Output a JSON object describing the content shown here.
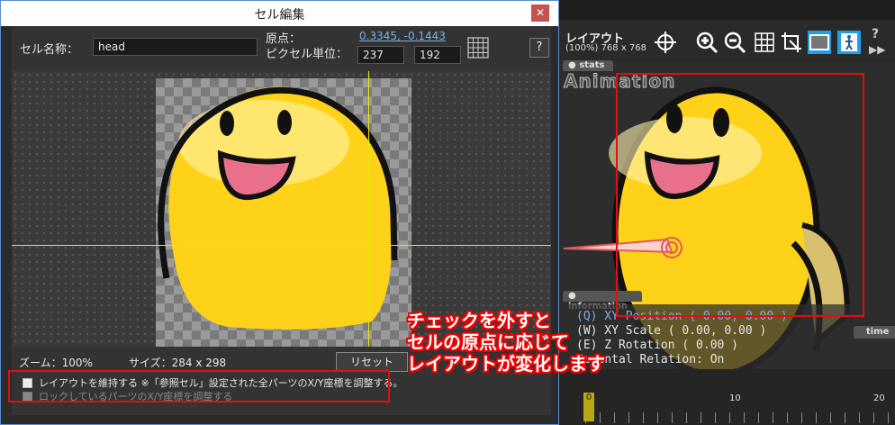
{
  "dialog": {
    "title": "セル編集",
    "close_glyph": "✕",
    "cell_name_label": "セル名称：",
    "cell_name_value": "head",
    "origin_label": "原点：",
    "origin_value": "0.3345, -0.1443",
    "pixel_unit_label": "ピクセル単位：",
    "pixel_x": "237",
    "pixel_y": "192",
    "help_label": "?",
    "zoom_text": "ズーム：100%",
    "size_text": "サイズ：284 x 298",
    "reset_label": "リセット",
    "keep_layout_text": "レイアウトを維持する ※「参照セル」設定された全パーツのX/Y座標を調整する。",
    "locked_parts_text": "ロックしているパーツのX/Y座標を調整する"
  },
  "layout_panel": {
    "title": "レイアウト",
    "resolution": "(100%) 768 x 768",
    "help": "?",
    "forward": "▶▶",
    "stats_tab": "stats",
    "animation_text": "Animation",
    "information_tab": "information",
    "time_tab": "time",
    "info_lines": [
      "(Q) XY Position ( 0.00, 0.00 )",
      "(W) XY Scale ( 0.00, 0.00 )",
      "(E) Z Rotation ( 0.00 )",
      "Parental Relation: On"
    ],
    "timeline_marker": "0",
    "timeline_labels": [
      "10",
      "20"
    ]
  },
  "annotation": {
    "lines": [
      "チェックを外すと",
      "セルの原点に応じて",
      "レイアウトが変化します"
    ]
  },
  "colors": {
    "accent_blue": "#1fa0e6",
    "annotation_red": "#e01010",
    "guide_yellow": "#e8e800",
    "character_yellow": "#ffd21a"
  }
}
